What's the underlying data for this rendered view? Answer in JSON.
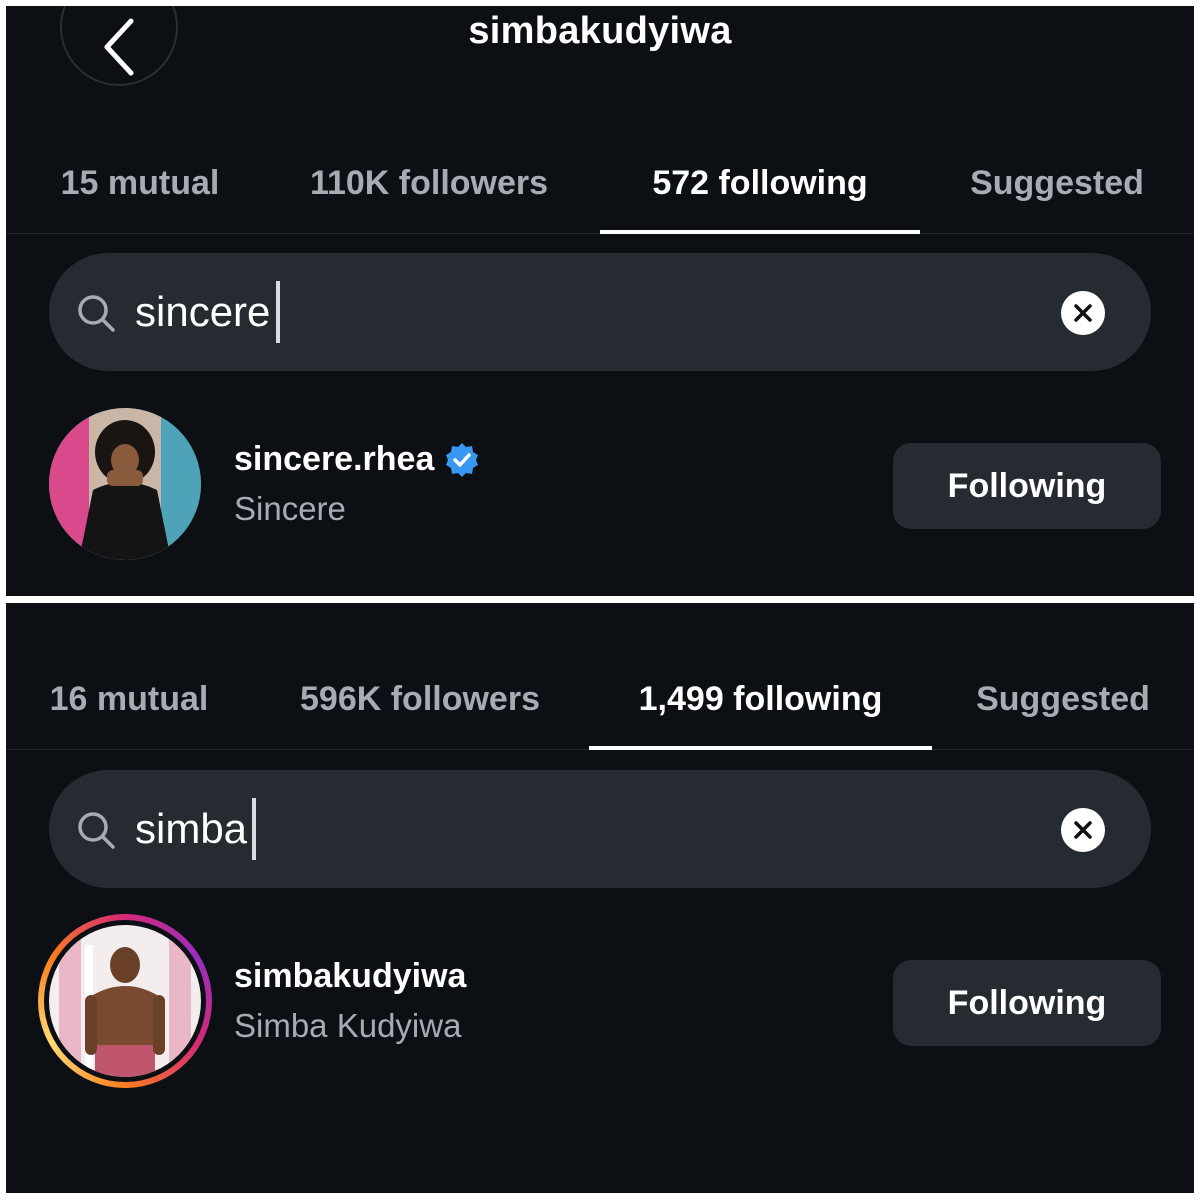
{
  "header": {
    "title": "simbakudyiwa",
    "back_icon": "chevron-left-icon"
  },
  "panels": [
    {
      "tabs": [
        {
          "label": "15 mutual",
          "active": false
        },
        {
          "label": "110K followers",
          "active": false
        },
        {
          "label": "572 following",
          "active": true
        },
        {
          "label": "Suggested",
          "active": false
        }
      ],
      "search": {
        "value": "sincere",
        "search_icon": "search-icon",
        "clear_icon": "clear-icon"
      },
      "result": {
        "username": "sincere.rhea",
        "full_name": "Sincere",
        "verified": true,
        "button_label": "Following"
      }
    },
    {
      "tabs": [
        {
          "label": "16 mutual",
          "active": false
        },
        {
          "label": "596K followers",
          "active": false
        },
        {
          "label": "1,499 following",
          "active": true
        },
        {
          "label": "Suggested",
          "active": false
        }
      ],
      "search": {
        "value": "simba",
        "search_icon": "search-icon",
        "clear_icon": "clear-icon"
      },
      "result": {
        "username": "simbakudyiwa",
        "full_name": "Simba Kudyiwa",
        "has_story_ring": true,
        "button_label": "Following"
      }
    }
  ],
  "colors": {
    "background": "#0c0f14",
    "surface": "#262a31",
    "text": "#ffffff",
    "muted_text": "#a7abb3",
    "verified_badge": "#3897f0"
  }
}
